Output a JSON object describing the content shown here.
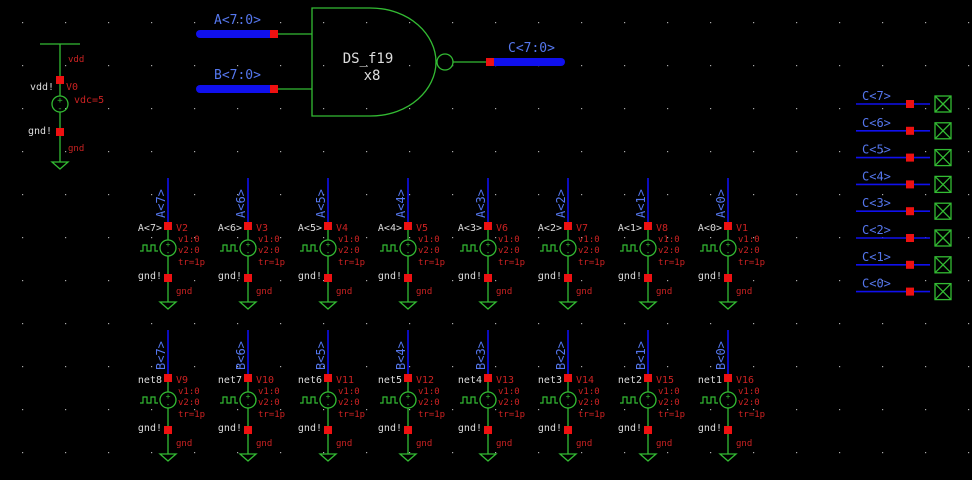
{
  "gate": {
    "name": "DS_f19",
    "mult": "x8",
    "in_a": "A<7:0>",
    "in_b": "B<7:0>",
    "out": "C<7:0>"
  },
  "vdd_source": {
    "net_top": "vdd",
    "left_top": "vdd!",
    "inst": "V0",
    "param": "vdc=5",
    "left_bot": "gnd!",
    "net_bot": "gnd"
  },
  "outputs": [
    "C<7>",
    "C<6>",
    "C<5>",
    "C<4>",
    "C<3>",
    "C<2>",
    "C<1>",
    "C<0>"
  ],
  "row_a": [
    {
      "pin": "A<7>",
      "net": "A<7>",
      "inst": "V2"
    },
    {
      "pin": "A<6>",
      "net": "A<6>",
      "inst": "V3"
    },
    {
      "pin": "A<5>",
      "net": "A<5>",
      "inst": "V4"
    },
    {
      "pin": "A<4>",
      "net": "A<4>",
      "inst": "V5"
    },
    {
      "pin": "A<3>",
      "net": "A<3>",
      "inst": "V6"
    },
    {
      "pin": "A<2>",
      "net": "A<2>",
      "inst": "V7"
    },
    {
      "pin": "A<1>",
      "net": "A<1>",
      "inst": "V8"
    },
    {
      "pin": "A<0>",
      "net": "A<0>",
      "inst": "V1"
    }
  ],
  "row_b": [
    {
      "pin": "B<7>",
      "net": "net8",
      "inst": "V9"
    },
    {
      "pin": "B<6>",
      "net": "net7",
      "inst": "V10"
    },
    {
      "pin": "B<5>",
      "net": "net6",
      "inst": "V11"
    },
    {
      "pin": "B<4>",
      "net": "net5",
      "inst": "V12"
    },
    {
      "pin": "B<3>",
      "net": "net4",
      "inst": "V13"
    },
    {
      "pin": "B<2>",
      "net": "net3",
      "inst": "V14"
    },
    {
      "pin": "B<1>",
      "net": "net2",
      "inst": "V15"
    },
    {
      "pin": "B<0>",
      "net": "net1",
      "inst": "V16"
    }
  ],
  "pulse_params": {
    "v1": "v1:0",
    "v2": "v2:0",
    "tr": "tr=1p"
  },
  "gnd_left": "gnd!",
  "gnd_net": "gnd",
  "colors": {
    "background": "#000000",
    "wire": "#33bb33",
    "bus": "#1010ee",
    "pin": "#ee1111",
    "net_label": "#5577ee",
    "label": "#dddddd",
    "attr": "#cc2222"
  }
}
